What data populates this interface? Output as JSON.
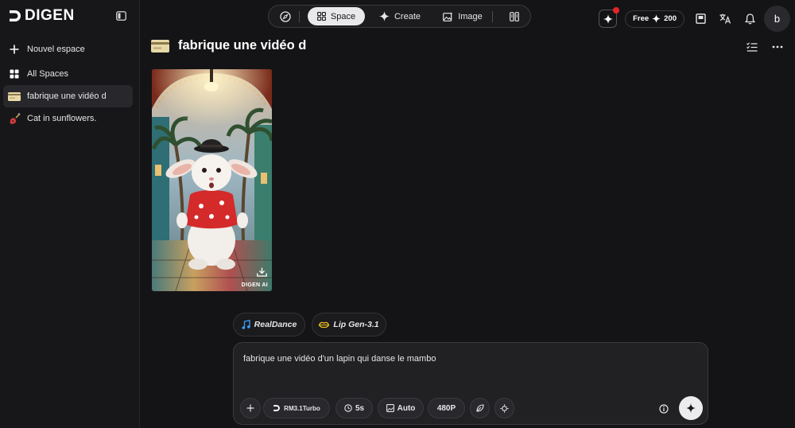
{
  "brand": {
    "name": "DIGEN"
  },
  "sidebar": {
    "items": [
      {
        "label": "Nouvel espace",
        "icon": "plus-icon"
      },
      {
        "label": "All Spaces",
        "icon": "grid-icon"
      },
      {
        "label": "fabrique une vidéo d",
        "icon": "card-icon",
        "active": true
      },
      {
        "label": "Cat in sunflowers.",
        "icon": "guitar-icon"
      }
    ]
  },
  "topnav": {
    "explore_icon": "compass-icon",
    "space_label": "Space",
    "create_label": "Create",
    "image_label": "Image",
    "columns_icon": "columns-icon"
  },
  "account": {
    "plan_label": "Free",
    "credits": "200",
    "avatar_initial": "b",
    "notification_dot_color": "#e5252a"
  },
  "space": {
    "title": "fabrique une vidéo d"
  },
  "video": {
    "watermark": "DIGEN AI"
  },
  "models": [
    {
      "label": "RealDance",
      "icon": "music-note-icon",
      "icon_color": "#3aa0ff"
    },
    {
      "label": "Lip Gen-3.1",
      "icon": "lips-icon",
      "icon_color": "#f2c21a"
    }
  ],
  "prompt": {
    "text": "fabrique une vidéo d'un lapin qui danse le mambo",
    "model": "RM3.1Turbo",
    "duration": "5s",
    "ratio": "Auto",
    "resolution": "480P"
  }
}
